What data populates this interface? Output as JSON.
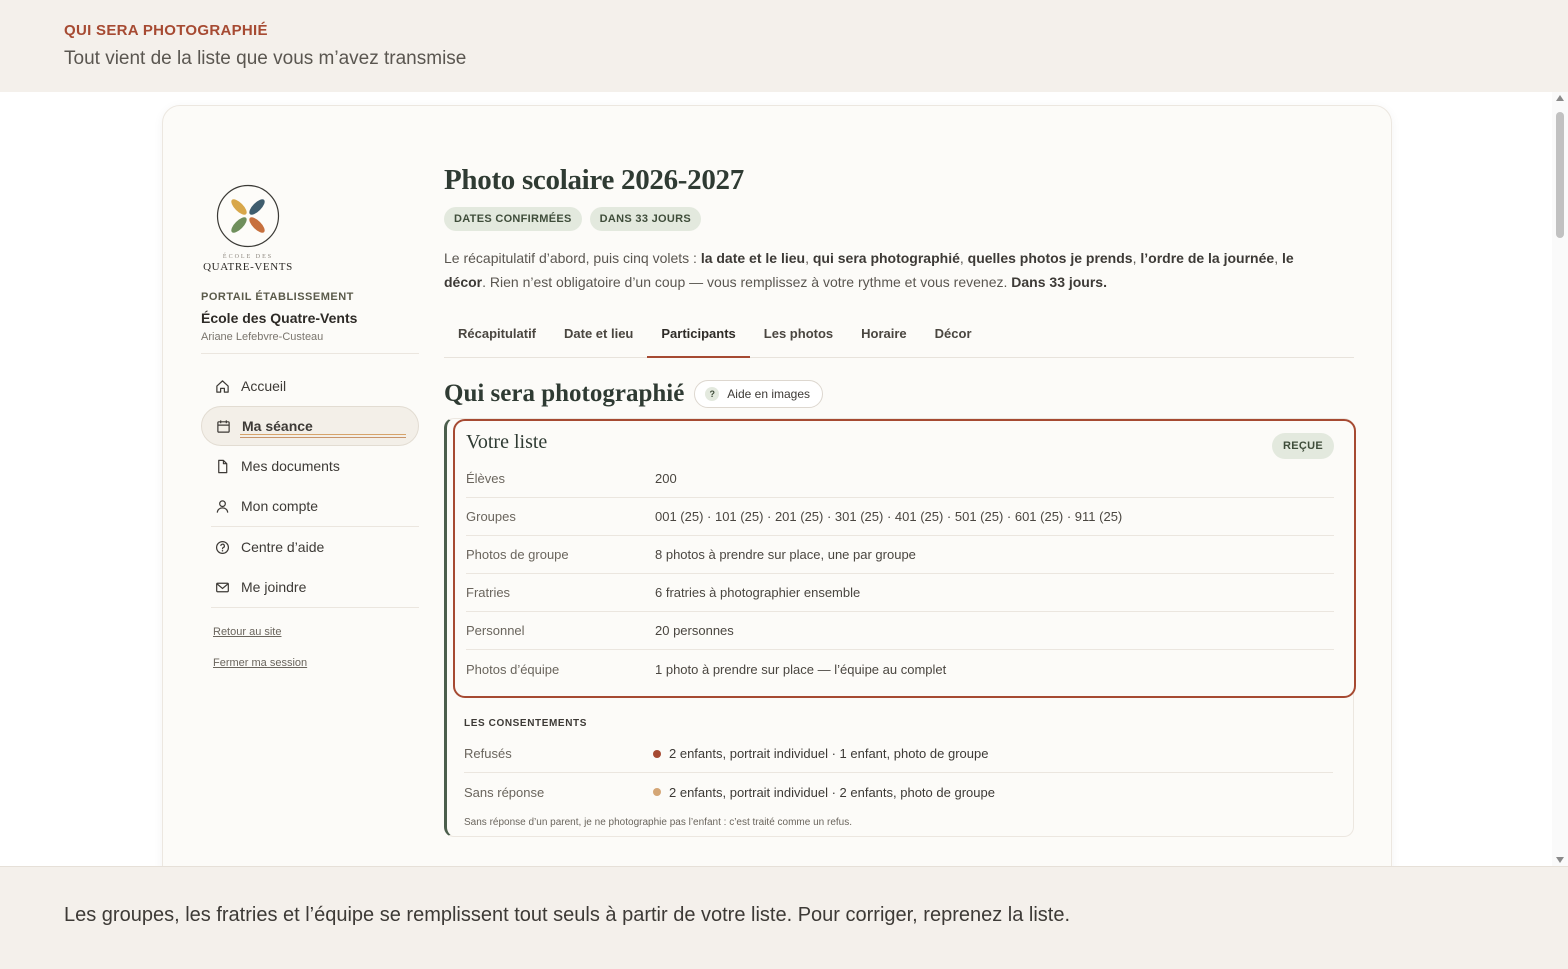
{
  "top_banner": {
    "kicker": "QUI SERA PHOTOGRAPHIÉ",
    "subtitle": "Tout vient de la liste que vous m’avez transmise"
  },
  "sidebar": {
    "logo_small": "ÉCOLE DES",
    "logo_big": "QUATRE-VENTS",
    "portal_label": "PORTAIL ÉTABLISSEMENT",
    "school_name": "École des Quatre-Vents",
    "person_name": "Ariane Lefebvre-Custeau",
    "nav": [
      {
        "label": "Accueil",
        "icon": "home-icon"
      },
      {
        "label": "Ma séance",
        "icon": "calendar-icon"
      },
      {
        "label": "Mes documents",
        "icon": "document-icon"
      },
      {
        "label": "Mon compte",
        "icon": "user-icon"
      },
      {
        "label": "Centre d’aide",
        "icon": "help-circle-icon"
      },
      {
        "label": "Me joindre",
        "icon": "mail-icon"
      }
    ],
    "links": [
      "Retour au site",
      "Fermer ma session"
    ]
  },
  "main": {
    "title": "Photo scolaire 2026-2027",
    "badges": [
      "DATES CONFIRMÉES",
      "DANS 33 JOURS"
    ],
    "intro": {
      "p1": "Le récapitulatif d’abord, puis cinq volets : ",
      "b1": "la date et le lieu",
      "s1": ", ",
      "b2": "qui sera photographié",
      "s2": ", ",
      "b3": "quelles photos je prends",
      "s3": ", ",
      "b4": "l’ordre de la journée",
      "s4": ", ",
      "b5": "le décor",
      "p2": ". Rien n’est obligatoire d’un coup — vous remplissez à votre rythme et vous revenez. ",
      "b6": "Dans 33 jours."
    },
    "tabs": [
      "Récapitulatif",
      "Date et lieu",
      "Participants",
      "Les photos",
      "Horaire",
      "Décor"
    ],
    "active_tab": "Participants",
    "section_title": "Qui sera photographié",
    "help_button": "Aide en images",
    "list": {
      "title": "Votre liste",
      "status": "REÇUE",
      "rows": [
        {
          "label": "Élèves",
          "value": "200"
        },
        {
          "label": "Groupes",
          "value": "001 (25) · 101 (25) · 201 (25) · 301 (25) · 401 (25) · 501 (25) · 601 (25) · 911 (25)"
        },
        {
          "label": "Photos de groupe",
          "value": "8 photos à prendre sur place, une par groupe"
        },
        {
          "label": "Fratries",
          "value": "6 fratries à photographier ensemble"
        },
        {
          "label": "Personnel",
          "value": "20 personnes"
        },
        {
          "label": "Photos d’équipe",
          "value": "1 photo à prendre sur place — l’équipe au complet"
        }
      ]
    },
    "consents": {
      "kicker": "LES CONSENTEMENTS",
      "rows": [
        {
          "label": "Refusés",
          "value": "2 enfants, portrait individuel · 1 enfant, photo de groupe",
          "color": "#a64a32"
        },
        {
          "label": "Sans réponse",
          "value": "2 enfants, portrait individuel · 2 enfants, photo de groupe",
          "color": "#d4a676"
        }
      ],
      "note": "Sans réponse d’un parent, je ne photographie pas l’enfant : c’est traité comme un refus."
    }
  },
  "bottom_banner": {
    "text": "Les groupes, les fratries et l’équipe se remplissent tout seuls à partir de votre liste. Pour corriger, reprenez la liste."
  },
  "colors": {
    "accent": "#a64a32",
    "green": "#4b5e4c",
    "badge_bg": "#e3e9de"
  }
}
